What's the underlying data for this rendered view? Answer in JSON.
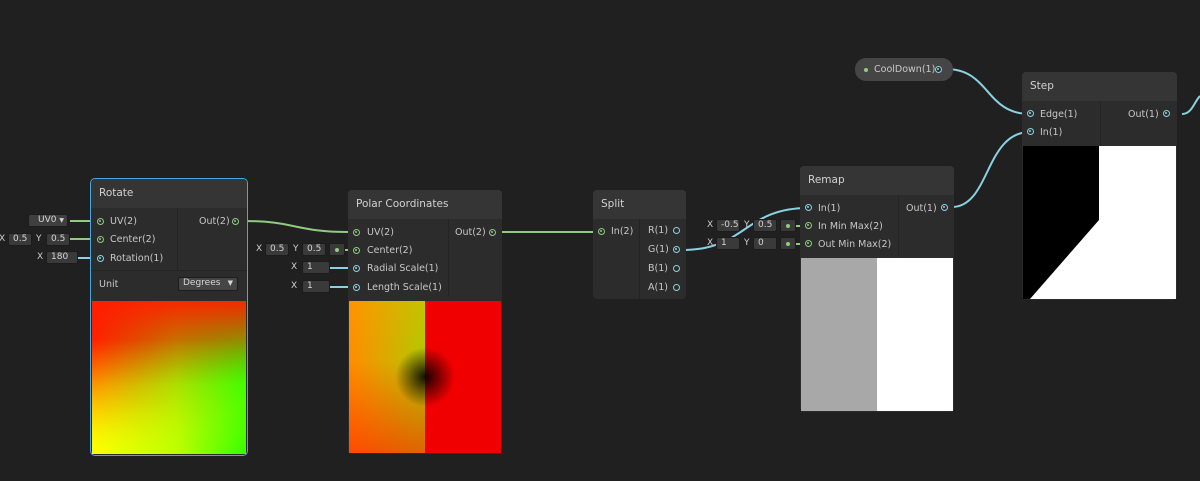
{
  "rotate": {
    "title": "Rotate",
    "inputs": [
      "UV(2)",
      "Center(2)",
      "Rotation(1)"
    ],
    "output": "Out(2)",
    "uv_dropdown": "UV0",
    "center": {
      "x_label": "X",
      "x": "0.5",
      "y_label": "Y",
      "y": "0.5"
    },
    "rotation": {
      "x_label": "X",
      "x": "180"
    },
    "unit_label": "Unit",
    "unit_value": "Degrees"
  },
  "polar": {
    "title": "Polar Coordinates",
    "inputs": [
      "UV(2)",
      "Center(2)",
      "Radial Scale(1)",
      "Length Scale(1)"
    ],
    "output": "Out(2)",
    "center": {
      "x_label": "X",
      "x": "0.5",
      "y_label": "Y",
      "y": "0.5"
    },
    "radial_scale": {
      "x_label": "X",
      "x": "1"
    },
    "length_scale": {
      "x_label": "X",
      "x": "1"
    }
  },
  "split": {
    "title": "Split",
    "input": "In(2)",
    "outputs": [
      "R(1)",
      "G(1)",
      "B(1)",
      "A(1)"
    ]
  },
  "remap": {
    "title": "Remap",
    "inputs": [
      "In(1)",
      "In Min Max(2)",
      "Out Min Max(2)"
    ],
    "output": "Out(1)",
    "in_min_max": {
      "x_label": "X",
      "x": "-0.5",
      "y_label": "Y",
      "y": "0.5"
    },
    "out_min_max": {
      "x_label": "X",
      "x": "1",
      "y_label": "Y",
      "y": "0"
    }
  },
  "property": {
    "label": "CoolDown(1)"
  },
  "step": {
    "title": "Step",
    "inputs": [
      "Edge(1)",
      "In(1)"
    ],
    "output": "Out(1)"
  },
  "colors": {
    "background": "#202020",
    "node": "#2c2c2c",
    "node_header": "#353535",
    "vector2_port": "#8fcc80",
    "vector1_port": "#8ad2e2",
    "selection": "#4aa6de"
  }
}
